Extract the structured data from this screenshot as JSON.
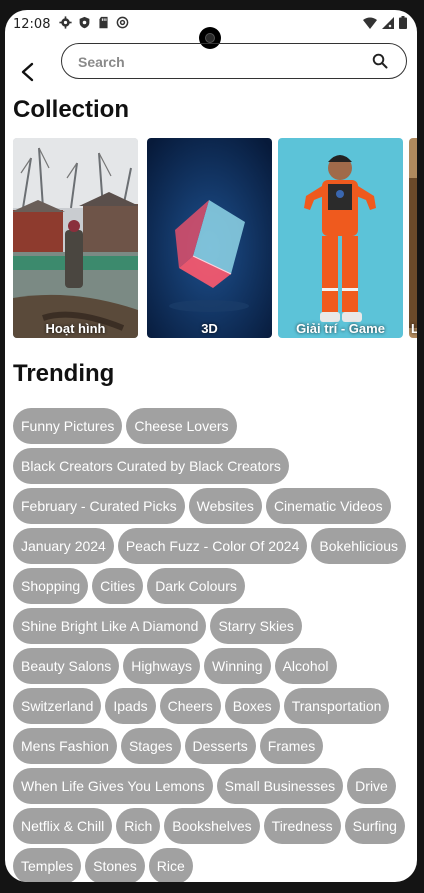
{
  "status_bar": {
    "time": "12:08"
  },
  "search": {
    "placeholder": "Search"
  },
  "collection": {
    "title": "Collection",
    "items": [
      {
        "label": "Hoạt hình"
      },
      {
        "label": "3D"
      },
      {
        "label": "Giải trí - Game"
      },
      {
        "label": "L"
      }
    ]
  },
  "trending": {
    "title": "Trending",
    "tags": [
      "Funny Pictures",
      "Cheese Lovers",
      "Black Creators Curated by Black Creators",
      "February - Curated Picks",
      "Websites",
      "Cinematic Videos",
      "January 2024",
      "Peach Fuzz - Color Of 2024",
      "Bokehlicious",
      "Shopping",
      "Cities",
      "Dark Colours",
      "Shine Bright Like A Diamond",
      "Starry Skies",
      "Beauty Salons",
      "Highways",
      "Winning",
      "Alcohol",
      "Switzerland",
      "Ipads",
      "Cheers",
      "Boxes",
      "Transportation",
      "Mens Fashion",
      "Stages",
      "Desserts",
      "Frames",
      "When Life Gives You Lemons",
      "Small Businesses",
      "Drive",
      "Netflix & Chill",
      "Rich",
      "Bookshelves",
      "Tiredness",
      "Surfing",
      "Temples",
      "Stones",
      "Rice"
    ]
  },
  "colors": {
    "tag_bg": "#a1a1a1",
    "tag_text": "#ffffff"
  },
  "icons": [
    "back-arrow-icon",
    "search-icon",
    "settings-icon",
    "shield-icon",
    "sd-card-icon",
    "at-sign-icon",
    "wifi-icon",
    "signal-icon",
    "battery-icon"
  ]
}
